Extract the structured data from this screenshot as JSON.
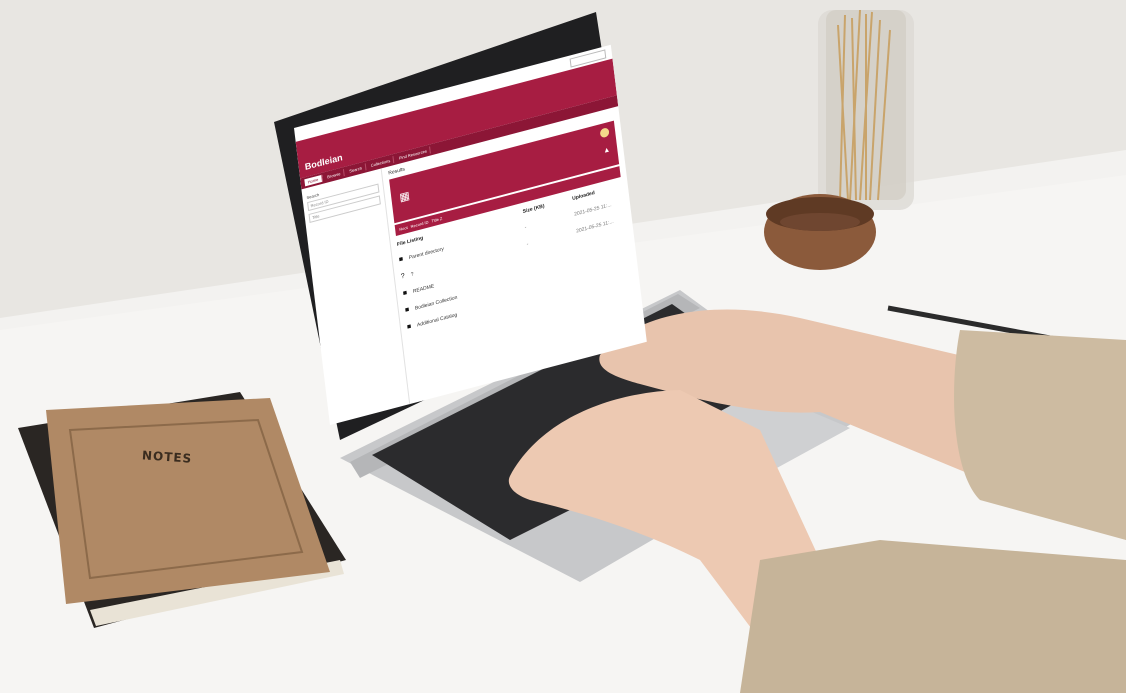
{
  "scene": {
    "notebook_label": "NOTES"
  },
  "screen_ui": {
    "brand": "Bodleian",
    "nav_tabs": [
      "Home",
      "Browse",
      "Search",
      "Collections",
      "Find Resources"
    ],
    "active_tab": 0,
    "side_labels": [
      "Search",
      "Record ID",
      "Title"
    ],
    "main_title": "Results",
    "subtoolbar_items": [
      "Root",
      "Record ID",
      "Title Z"
    ],
    "columns": {
      "name": "File Listing",
      "size": "Size (KB)",
      "date": "Uploaded"
    },
    "rows": [
      {
        "icon": "folder-icon",
        "name": "Parent directory",
        "size": "-",
        "date": "2021-05-25 11:..."
      },
      {
        "icon": "question-icon",
        "name": "?",
        "size": "-",
        "date": "2021-05-25 11:..."
      },
      {
        "icon": "file-icon",
        "name": "README",
        "size": "",
        "date": ""
      },
      {
        "icon": "file-icon",
        "name": "Bodleian Collection",
        "size": "",
        "date": ""
      },
      {
        "icon": "file-icon",
        "name": "Additional Catalog",
        "size": "",
        "date": ""
      }
    ]
  },
  "colors": {
    "brand_crimson": "#a71d42",
    "desk": "#f2f1ef",
    "wall": "#e8e6e2"
  }
}
